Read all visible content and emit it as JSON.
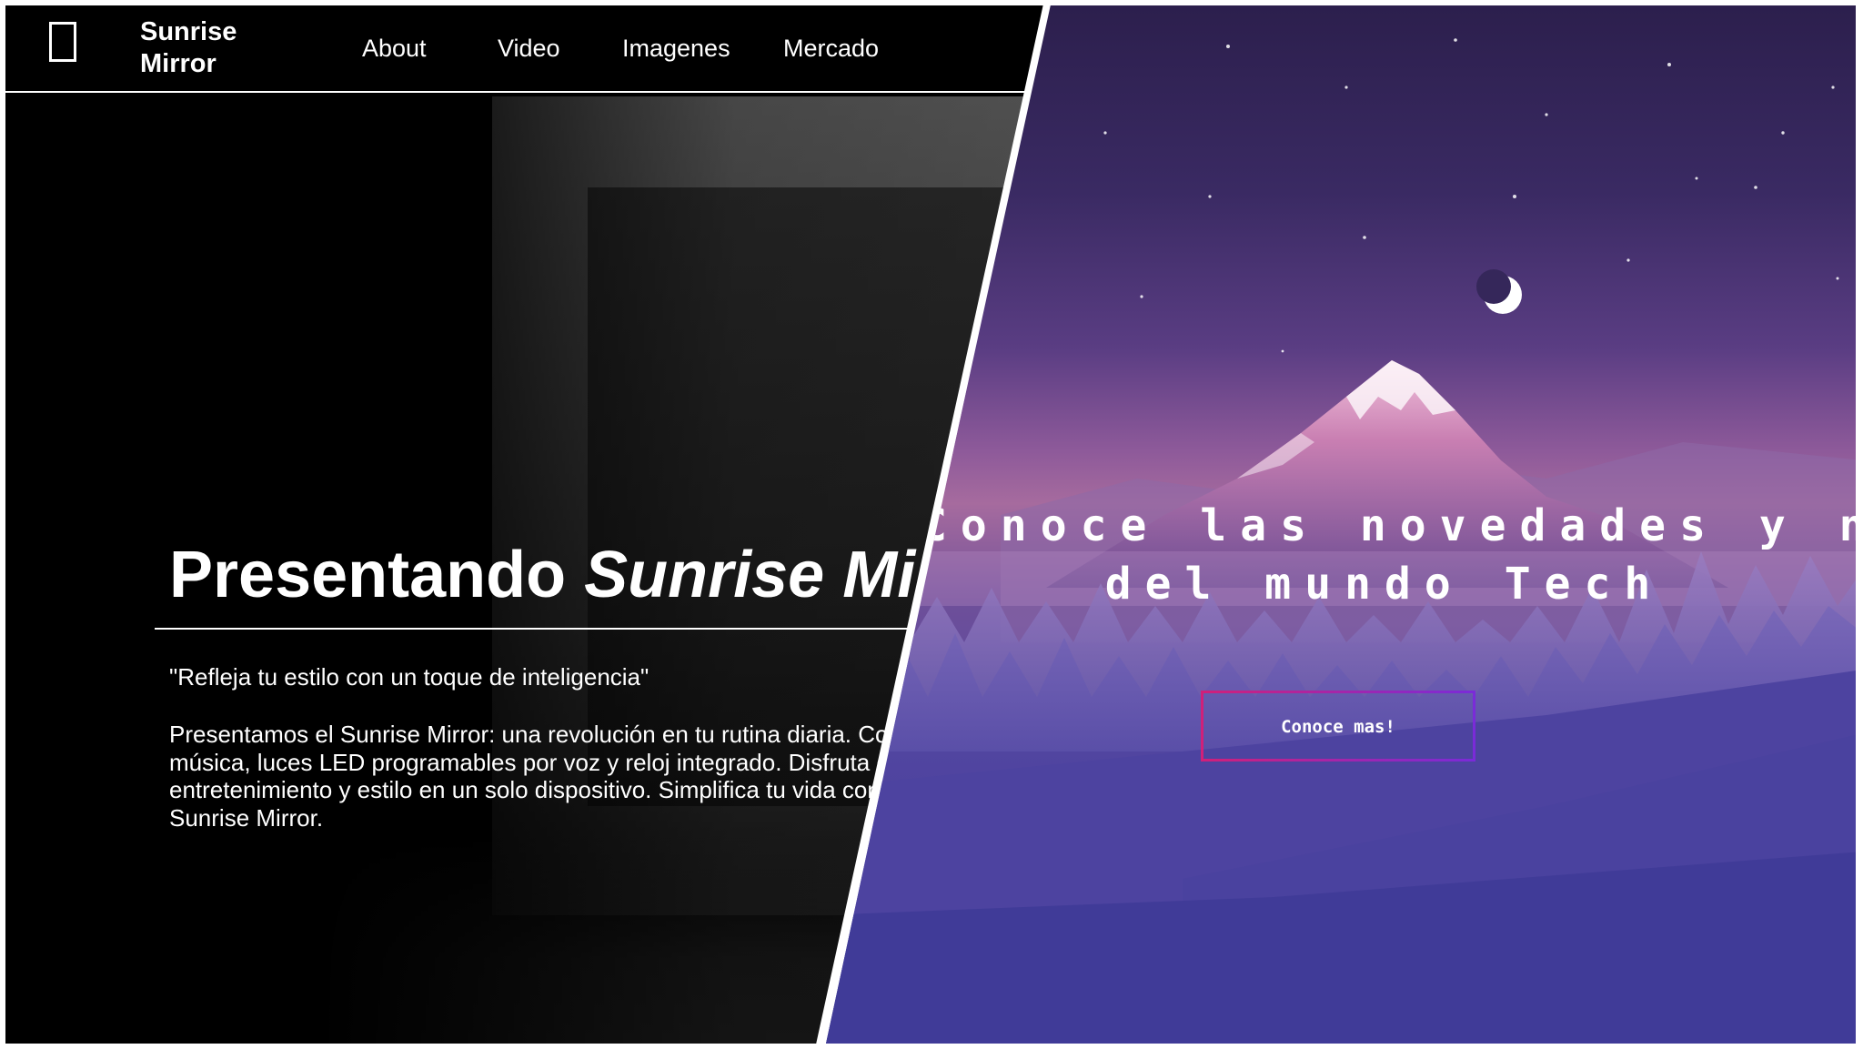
{
  "left_site": {
    "brand": "Sunrise\nMirror",
    "nav": [
      {
        "label": "About"
      },
      {
        "label": "Video"
      },
      {
        "label": "Imagenes"
      },
      {
        "label": "Mercado"
      }
    ],
    "hero": {
      "title_plain": "Presentando ",
      "title_emphasis": "Sunrise Mirror",
      "tagline": "\"Refleja tu estilo con un toque de inteligencia\"",
      "description": "Presentamos el Sunrise Mirror: una revolución en tu rutina diaria. Con\nmúsica, luces LED programables por voz y reloj integrado. Disfruta de\nentretenimiento y estilo en un solo dispositivo. Simplifica tu vida con el\nSunrise Mirror."
    }
  },
  "right_site": {
    "headline_line1": "Conoce las novedades y noticias",
    "headline_line2": "del mundo Tech",
    "cta_label": "Conoce mas!"
  },
  "colors": {
    "left_background": "#000000",
    "right_sky_top": "#2c1f4d",
    "right_glow": "#a66b9e",
    "right_bottom": "#3f3b97",
    "cta_border_start": "#d0207a",
    "cta_border_end": "#7a2bd8"
  },
  "icons": {
    "logo": "mirror-outline-icon",
    "moon": "crescent-moon-icon"
  }
}
